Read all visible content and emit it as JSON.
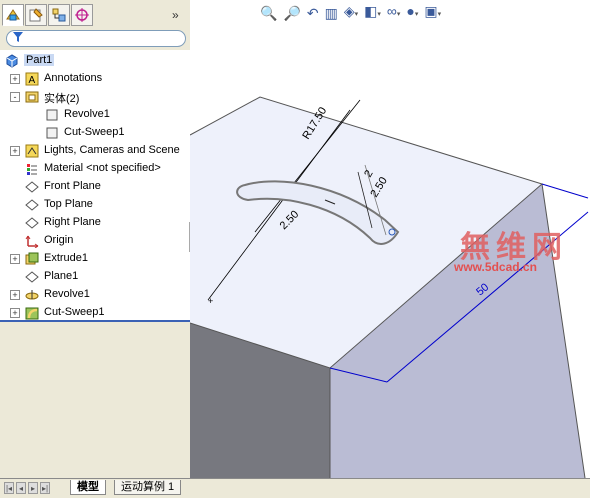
{
  "feature_manager": {
    "tabs": [
      {
        "name": "feature-manager-tab-icon"
      },
      {
        "name": "property-manager-tab-icon"
      },
      {
        "name": "configuration-manager-tab-icon"
      },
      {
        "name": "dim-xpert-tab-icon"
      }
    ],
    "filter_icon": "funnel-icon",
    "items": [
      {
        "label": "Part1",
        "icon": "part-icon",
        "indent": 0,
        "expander": "",
        "selected": true
      },
      {
        "label": "Annotations",
        "icon": "annotations-icon",
        "indent": 1,
        "expander": "+"
      },
      {
        "label": "实体(2)",
        "icon": "solid-bodies-icon",
        "indent": 1,
        "expander": "-"
      },
      {
        "label": "Revolve1",
        "icon": "body-icon",
        "indent": 2,
        "expander": ""
      },
      {
        "label": "Cut-Sweep1",
        "icon": "body-icon",
        "indent": 2,
        "expander": ""
      },
      {
        "label": "Lights, Cameras and Scene",
        "icon": "lights-icon",
        "indent": 1,
        "expander": "+"
      },
      {
        "label": "Material <not specified>",
        "icon": "material-icon",
        "indent": 1,
        "expander": ""
      },
      {
        "label": "Front Plane",
        "icon": "plane-icon",
        "indent": 1,
        "expander": ""
      },
      {
        "label": "Top Plane",
        "icon": "plane-icon",
        "indent": 1,
        "expander": ""
      },
      {
        "label": "Right Plane",
        "icon": "plane-icon",
        "indent": 1,
        "expander": ""
      },
      {
        "label": "Origin",
        "icon": "origin-icon",
        "indent": 1,
        "expander": ""
      },
      {
        "label": "Extrude1",
        "icon": "extrude-icon",
        "indent": 1,
        "expander": "+"
      },
      {
        "label": "Plane1",
        "icon": "plane-icon",
        "indent": 1,
        "expander": ""
      },
      {
        "label": "Revolve1",
        "icon": "revolve-icon",
        "indent": 1,
        "expander": "+"
      },
      {
        "label": "Cut-Sweep1",
        "icon": "cut-sweep-icon",
        "indent": 1,
        "expander": "+"
      }
    ]
  },
  "bottom_tabs": {
    "model": "模型",
    "motion": "运动算例 1"
  },
  "viewport": {
    "dimensions": {
      "width_value": "50",
      "diagonal_value": "R17.50",
      "sweep_width_a": "2.50",
      "sweep_width_b": "2.50",
      "small_dim": "2",
      "edge_value": "50"
    },
    "watermark_cn": "無维网",
    "watermark_url": "www.5dcad.cn"
  },
  "toolbar": {
    "icons": [
      "zoom-to-fit-icon",
      "zoom-to-area-icon",
      "previous-view-icon",
      "section-view-icon",
      "view-orientation-icon",
      "display-style-icon",
      "hide-show-items-icon",
      "edit-appearance-icon",
      "apply-scene-icon"
    ]
  },
  "colors": {
    "panel_bg": "#ece9d8",
    "selection": "#c9d9f3",
    "dimension_blue": "#0000cc",
    "watermark": "#e06060"
  }
}
